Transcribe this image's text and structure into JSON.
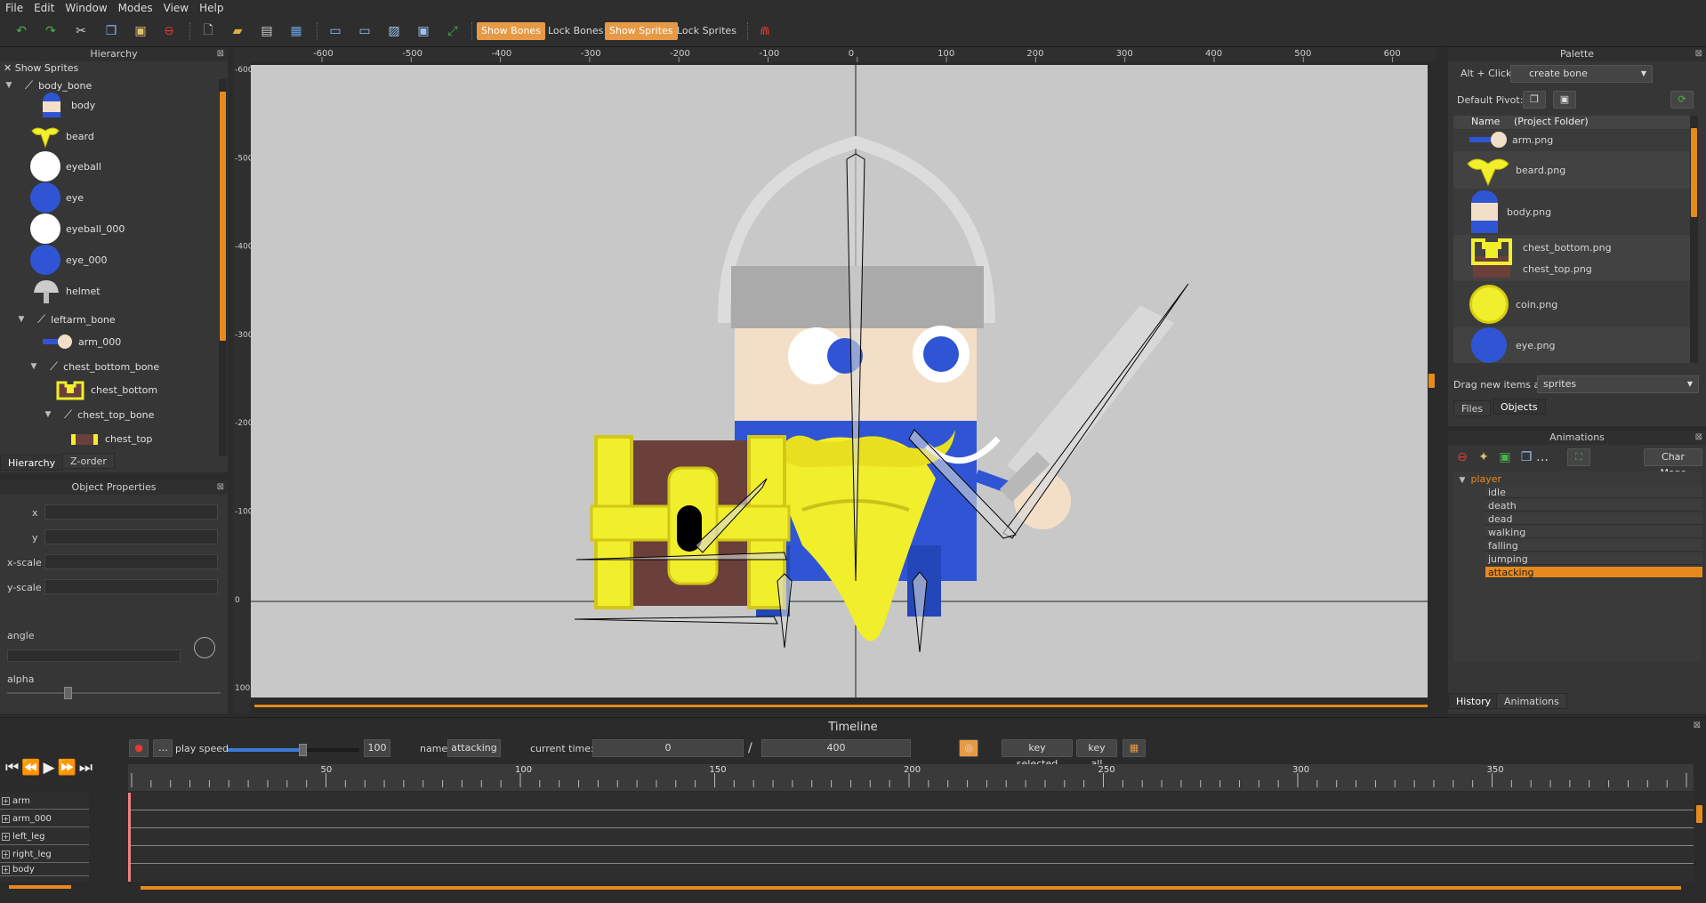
{
  "menu": [
    "File",
    "Edit",
    "Window",
    "Modes",
    "View",
    "Help"
  ],
  "toolbar": {
    "show_bones": "Show Bones",
    "lock_bones": "Lock Bones",
    "show_sprites": "Show Sprites",
    "lock_sprites": "Lock Sprites"
  },
  "hierarchy": {
    "title": "Hierarchy",
    "show_sprites": "Show Sprites",
    "items": [
      {
        "label": "body_bone",
        "icon": "bone-icon"
      },
      {
        "label": "body",
        "icon": "body-sprite-icon"
      },
      {
        "label": "beard",
        "icon": "beard-sprite-icon"
      },
      {
        "label": "eyeball",
        "icon": "eyeball-sprite-icon"
      },
      {
        "label": "eye",
        "icon": "eye-sprite-icon"
      },
      {
        "label": "eyeball_000",
        "icon": "eyeball-sprite-icon"
      },
      {
        "label": "eye_000",
        "icon": "eye-sprite-icon"
      },
      {
        "label": "helmet",
        "icon": "helmet-sprite-icon"
      },
      {
        "label": "leftarm_bone",
        "icon": "bone-icon"
      },
      {
        "label": "arm_000",
        "icon": "arm-sprite-icon"
      },
      {
        "label": "chest_bottom_bone",
        "icon": "bone-icon"
      },
      {
        "label": "chest_bottom",
        "icon": "chest-bottom-sprite-icon"
      },
      {
        "label": "chest_top_bone",
        "icon": "bone-icon"
      },
      {
        "label": "chest_top",
        "icon": "chest-top-sprite-icon"
      }
    ],
    "tabs": [
      "Hierarchy",
      "Z-order"
    ]
  },
  "properties": {
    "title": "Object Properties",
    "x": "x",
    "y": "y",
    "xscale": "x-scale",
    "yscale": "y-scale",
    "angle": "angle",
    "alpha": "alpha"
  },
  "canvas": {
    "h_ticks": [
      "-600",
      "-500",
      "-400",
      "-300",
      "-200",
      "-100",
      "0",
      "100",
      "200",
      "300",
      "400",
      "500",
      "600"
    ],
    "v_ticks": [
      "-600",
      "-500",
      "-400",
      "-300",
      "-200",
      "-100",
      "0",
      "100"
    ]
  },
  "palette": {
    "title": "Palette",
    "alt_click": "Alt + Click:",
    "create_bone": "create bone",
    "default_pivot": "Default Pivot:",
    "col_name": "Name",
    "col_folder": "(Project Folder)",
    "files": [
      "arm.png",
      "beard.png",
      "body.png",
      "chest_bottom.png",
      "chest_top.png",
      "coin.png",
      "eye.png"
    ],
    "drag_label": "Drag new items as",
    "drag_value": "sprites",
    "tabs": [
      "Files",
      "Objects"
    ]
  },
  "animations": {
    "title": "Animations",
    "char_maps": "Char Maps",
    "entity": "player",
    "items": [
      "idle",
      "death",
      "dead",
      "walking",
      "falling",
      "jumping",
      "attacking"
    ],
    "selected": "attacking",
    "bottom_tabs": [
      "History",
      "Animations"
    ]
  },
  "timeline": {
    "title": "Timeline",
    "play_speed_label": "play speed",
    "play_speed": "100",
    "name_label": "name",
    "name_value": "attacking",
    "current_time_label": "current time:",
    "current_time": "0",
    "slash": "/",
    "length": "400",
    "key_selected": "key selected",
    "key_all": "key all",
    "ruler": [
      "50",
      "100",
      "150",
      "200",
      "250",
      "300",
      "350"
    ],
    "tracks": [
      "arm",
      "arm_000",
      "left_leg",
      "right_leg",
      "body"
    ]
  },
  "colors": {
    "accent": "#e68a1e",
    "canvas_bg": "#c8c8c8",
    "sprite_blue": "#2f55d4",
    "sprite_yellow": "#f1ee2c",
    "skin": "#f3dfc8"
  }
}
